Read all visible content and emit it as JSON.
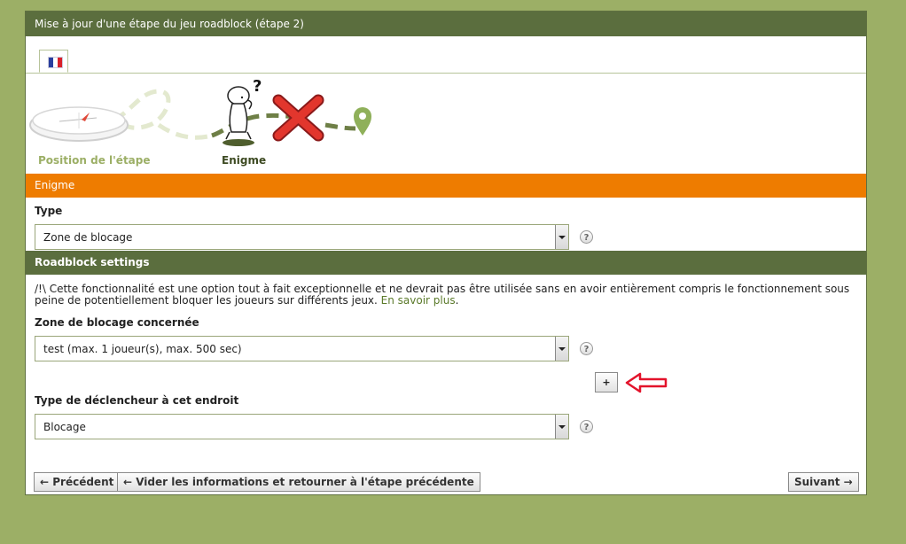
{
  "title": "Mise à jour d'une étape du jeu roadblock (étape 2)",
  "language_tab": {
    "icon": "flag-fr-icon",
    "colors": [
      "#2a3f9e",
      "#ffffff",
      "#d8212a"
    ]
  },
  "steps": [
    {
      "label": "Position de l'étape",
      "icon": "compass-icon",
      "state": "done"
    },
    {
      "label": "Enigme",
      "icon": "thinking-character-icon",
      "state": "current"
    }
  ],
  "enigme_section": {
    "title": "Enigme",
    "type_label": "Type",
    "type_value": "Zone de blocage"
  },
  "roadblock_section": {
    "title": "Roadblock settings",
    "warning_text": "/!\\ Cette fonctionnalité est une option tout à fait exceptionnelle et ne devrait pas être utilisée sans en avoir entièrement compris le fonctionnement sous peine de potentiellement bloquer les joueurs sur différents jeux. ",
    "warning_link": "En savoir plus",
    "warning_end": ".",
    "zone_label": "Zone de blocage concernée",
    "zone_value": "test (max. 1 joueur(s), max. 500 sec)",
    "add_label": "+",
    "trigger_label": "Type de déclencheur à cet endroit",
    "trigger_value": "Blocage"
  },
  "help_symbol": "?",
  "buttons": {
    "previous": "← Précédent",
    "clear_and_back": "← Vider les informations et retourner à l'étape précédente",
    "next": "Suivant →"
  }
}
